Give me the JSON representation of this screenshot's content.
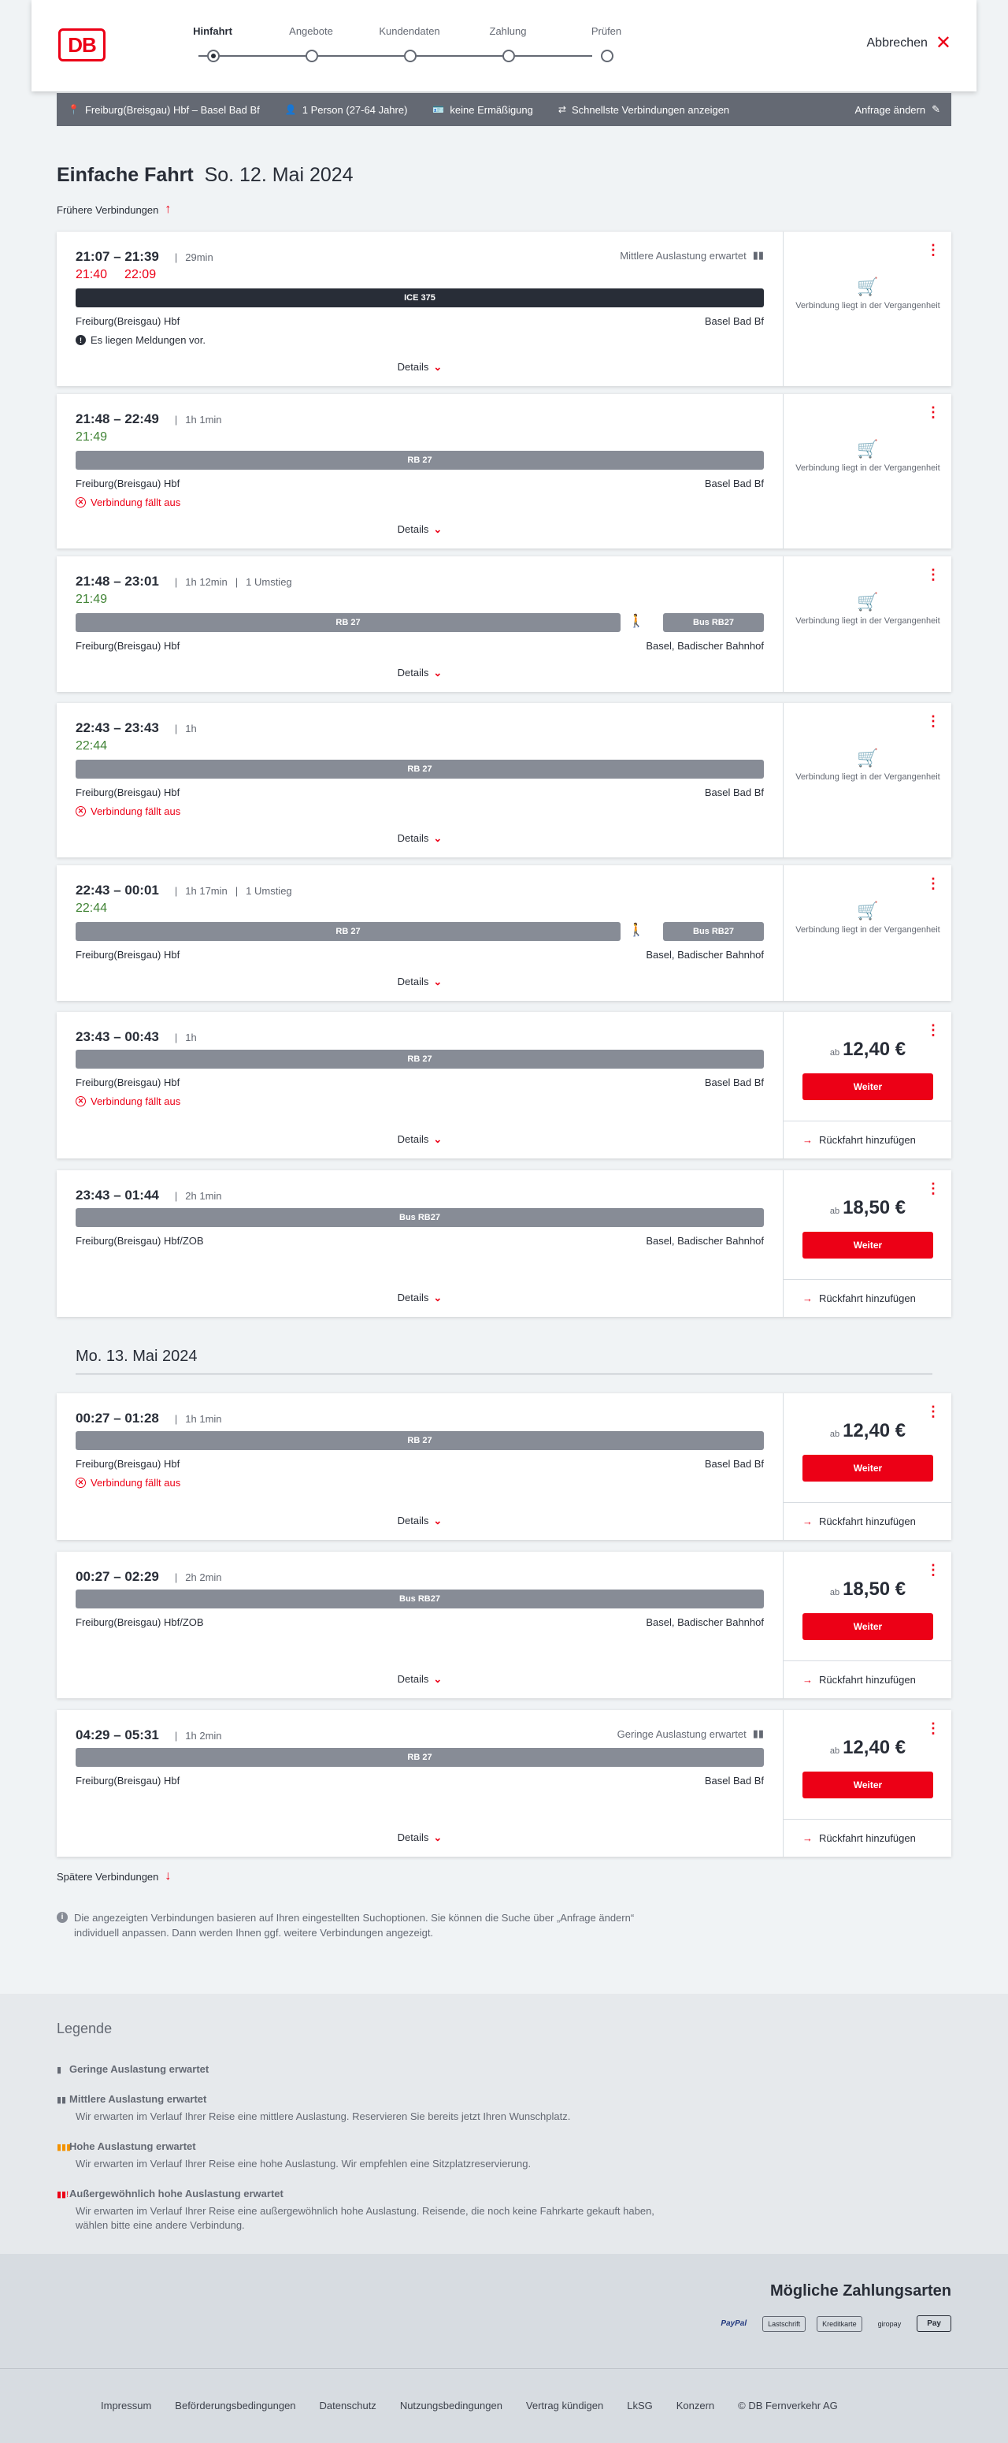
{
  "header": {
    "logo_text": "DB",
    "steps": [
      {
        "label": "Hinfahrt",
        "active": true
      },
      {
        "label": "Angebote",
        "active": false
      },
      {
        "label": "Kundendaten",
        "active": false
      },
      {
        "label": "Zahlung",
        "active": false
      },
      {
        "label": "Prüfen",
        "active": false
      }
    ],
    "cancel_label": "Abbrechen"
  },
  "query": {
    "route": "Freiburg(Breisgau) Hbf – Basel Bad Bf",
    "travellers": "1 Person (27-64 Jahre)",
    "discount": "keine Ermäßigung",
    "fast": "Schnellste Verbindungen anzeigen",
    "change_label": "Anfrage ändern"
  },
  "page": {
    "title": "Einfache Fahrt",
    "date": "So. 12. Mai 2024",
    "earlier_label": "Frühere Verbindungen",
    "later_label": "Spätere Verbindungen",
    "second_date": "Mo. 13. Mai 2024",
    "info_note": "Die angezeigten Verbindungen basieren auf Ihren eingestellten Suchoptionen. Sie können die Suche über „Anfrage ändern“ individuell anpassen. Dann werden Ihnen ggf. weitere Verbindungen angezeigt."
  },
  "labels": {
    "details": "Details",
    "past": "Verbindung liegt in der Vergangenheit",
    "ab": "ab",
    "weiter": "Weiter",
    "return": "Rückfahrt hinzufügen"
  },
  "connections": [
    {
      "times": "21:07 – 21:39",
      "duration": "29min",
      "transfers": "",
      "rt": [
        "21:40",
        "22:09"
      ],
      "rt_class": "late",
      "load": "Mittlere Auslastung erwartet",
      "bars": [
        {
          "label": "ICE 375",
          "dark": true
        }
      ],
      "from": "Freiburg(Breisgau) Hbf",
      "to": "Basel Bad Bf",
      "warn": "Es liegen Meldungen vor.",
      "warn_type": "info",
      "price": "",
      "past": true
    },
    {
      "times": "21:48 – 22:49",
      "duration": "1h 1min",
      "transfers": "",
      "rt": [
        "21:49"
      ],
      "rt_class": "ok",
      "load": "",
      "bars": [
        {
          "label": "RB 27",
          "dark": false
        }
      ],
      "from": "Freiburg(Breisgau) Hbf",
      "to": "Basel Bad Bf",
      "warn": "Verbindung fällt aus",
      "warn_type": "cancelled",
      "price": "",
      "past": true
    },
    {
      "times": "21:48 – 23:01",
      "duration": "1h 12min",
      "transfers": "1 Umstieg",
      "rt": [
        "21:49"
      ],
      "rt_class": "ok",
      "load": "",
      "bars": [
        {
          "label": "RB 27",
          "dark": false
        },
        {
          "label": "Bus RB27",
          "dark": false
        }
      ],
      "from": "Freiburg(Breisgau) Hbf",
      "to": "Basel, Badischer Bahnhof",
      "warn": "",
      "warn_type": "",
      "price": "",
      "past": true
    },
    {
      "times": "22:43 – 23:43",
      "duration": "1h",
      "transfers": "",
      "rt": [
        "22:44"
      ],
      "rt_class": "ok",
      "load": "",
      "bars": [
        {
          "label": "RB 27",
          "dark": false
        }
      ],
      "from": "Freiburg(Breisgau) Hbf",
      "to": "Basel Bad Bf",
      "warn": "Verbindung fällt aus",
      "warn_type": "cancelled",
      "price": "",
      "past": true
    },
    {
      "times": "22:43 – 00:01",
      "duration": "1h 17min",
      "transfers": "1 Umstieg",
      "rt": [
        "22:44"
      ],
      "rt_class": "ok",
      "load": "",
      "bars": [
        {
          "label": "RB 27",
          "dark": false
        },
        {
          "label": "Bus RB27",
          "dark": false
        }
      ],
      "from": "Freiburg(Breisgau) Hbf",
      "to": "Basel, Badischer Bahnhof",
      "warn": "",
      "warn_type": "",
      "price": "",
      "past": true
    },
    {
      "times": "23:43 – 00:43",
      "duration": "1h",
      "transfers": "",
      "rt": [],
      "rt_class": "",
      "load": "",
      "bars": [
        {
          "label": "RB 27",
          "dark": false
        }
      ],
      "from": "Freiburg(Breisgau) Hbf",
      "to": "Basel Bad Bf",
      "warn": "Verbindung fällt aus",
      "warn_type": "cancelled",
      "price": "12,40 €",
      "past": false
    },
    {
      "times": "23:43 – 01:44",
      "duration": "2h 1min",
      "transfers": "",
      "rt": [],
      "rt_class": "",
      "load": "",
      "bars": [
        {
          "label": "Bus RB27",
          "dark": false
        }
      ],
      "from": "Freiburg(Breisgau) Hbf/ZOB",
      "to": "Basel, Badischer Bahnhof",
      "warn": "",
      "warn_type": "",
      "price": "18,50 €",
      "past": false
    },
    {
      "times": "00:27 – 01:28",
      "duration": "1h 1min",
      "transfers": "",
      "rt": [],
      "rt_class": "",
      "load": "",
      "bars": [
        {
          "label": "RB 27",
          "dark": false
        }
      ],
      "from": "Freiburg(Breisgau) Hbf",
      "to": "Basel Bad Bf",
      "warn": "Verbindung fällt aus",
      "warn_type": "cancelled",
      "price": "12,40 €",
      "past": false
    },
    {
      "times": "00:27 – 02:29",
      "duration": "2h 2min",
      "transfers": "",
      "rt": [],
      "rt_class": "",
      "load": "",
      "bars": [
        {
          "label": "Bus RB27",
          "dark": false
        }
      ],
      "from": "Freiburg(Breisgau) Hbf/ZOB",
      "to": "Basel, Badischer Bahnhof",
      "warn": "",
      "warn_type": "",
      "price": "18,50 €",
      "past": false
    },
    {
      "times": "04:29 – 05:31",
      "duration": "1h 2min",
      "transfers": "",
      "rt": [],
      "rt_class": "",
      "load": "Geringe Auslastung erwartet",
      "bars": [
        {
          "label": "RB 27",
          "dark": false
        }
      ],
      "from": "Freiburg(Breisgau) Hbf",
      "to": "Basel Bad Bf",
      "warn": "",
      "warn_type": "",
      "price": "12,40 €",
      "past": false
    }
  ],
  "legend": {
    "title": "Legende",
    "items": [
      {
        "title": "Geringe Auslastung erwartet",
        "text": ""
      },
      {
        "title": "Mittlere Auslastung erwartet",
        "text": "Wir erwarten im Verlauf Ihrer Reise eine mittlere Auslastung. Reservieren Sie bereits jetzt Ihren Wunschplatz."
      },
      {
        "title": "Hohe Auslastung erwartet",
        "text": "Wir erwarten im Verlauf Ihrer Reise eine hohe Auslastung. Wir empfehlen eine Sitzplatzreservierung."
      },
      {
        "title": "Außergewöhnlich hohe Auslastung erwartet",
        "text": "Wir erwarten im Verlauf Ihrer Reise eine außergewöhnlich hohe Auslastung. Reisende, die noch keine Fahrkarte gekauft haben, wählen bitte eine andere Verbindung."
      }
    ]
  },
  "payment": {
    "title": "Mögliche Zahlungsarten",
    "methods": [
      "PayPal",
      "Lastschrift",
      "Kreditkarte",
      "giropay",
      "Pay"
    ]
  },
  "footer": {
    "links": [
      "Impressum",
      "Beförderungsbedingungen",
      "Datenschutz",
      "Nutzungsbedingungen",
      "Vertrag kündigen",
      "LkSG",
      "Konzern",
      "© DB Fernverkehr AG"
    ]
  },
  "colors": {
    "accent": "#ec0016",
    "bar": "#878c96",
    "bar_dark": "#282d37",
    "ok": "#408335"
  }
}
